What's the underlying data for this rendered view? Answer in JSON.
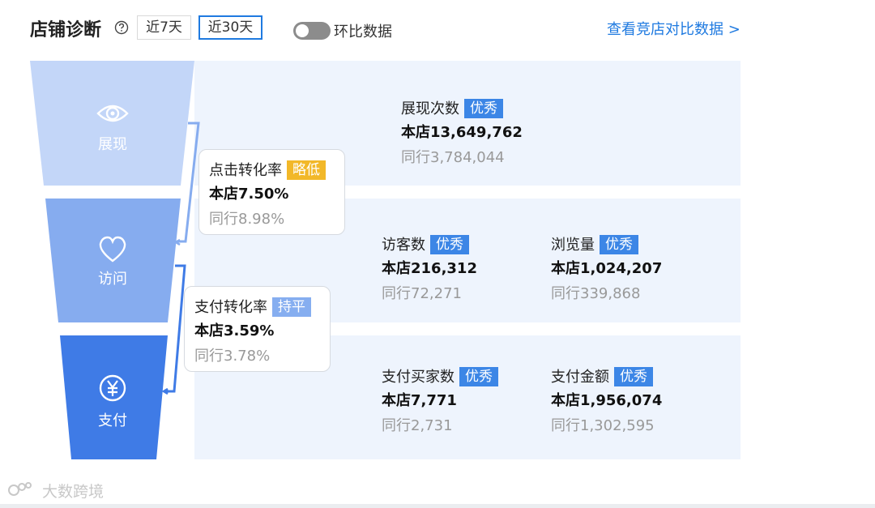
{
  "header": {
    "title": "店铺诊断",
    "periods": [
      "近7天",
      "近30天"
    ],
    "active_period": "近30天",
    "toggle_label": "环比数据",
    "toggle_on": false,
    "compare_link": "查看竞店对比数据 >"
  },
  "funnel": {
    "stages": [
      {
        "label": "展现",
        "icon": "eye-icon"
      },
      {
        "label": "访问",
        "icon": "heart-icon"
      },
      {
        "label": "支付",
        "icon": "yen-icon"
      }
    ],
    "rates": [
      {
        "name": "点击转化率",
        "badge": "略低",
        "store": "本店7.50%",
        "peer": "同行8.98%"
      },
      {
        "name": "支付转化率",
        "badge": "持平",
        "store": "本店3.59%",
        "peer": "同行3.78%"
      }
    ]
  },
  "metrics": {
    "impressions": {
      "name": "展现次数",
      "badge": "优秀",
      "store": "本店13,649,762",
      "peer": "同行3,784,044"
    },
    "visitors": {
      "name": "访客数",
      "badge": "优秀",
      "store": "本店216,312",
      "peer": "同行72,271"
    },
    "pageviews": {
      "name": "浏览量",
      "badge": "优秀",
      "store": "本店1,024,207",
      "peer": "同行339,868"
    },
    "buyers": {
      "name": "支付买家数",
      "badge": "优秀",
      "store": "本店7,771",
      "peer": "同行2,731"
    },
    "amount": {
      "name": "支付金额",
      "badge": "优秀",
      "store": "本店1,956,074",
      "peer": "同行1,302,595"
    }
  },
  "watermark": "大数跨境",
  "colors": {
    "accent": "#1f7ae0",
    "badge_excellent": "#3c86e6",
    "badge_low": "#f2b829",
    "badge_par": "#86aef0",
    "stage1": "#c3d6f8",
    "stage2": "#86acef",
    "stage3": "#3f7be6",
    "band": "#eef4fd"
  }
}
